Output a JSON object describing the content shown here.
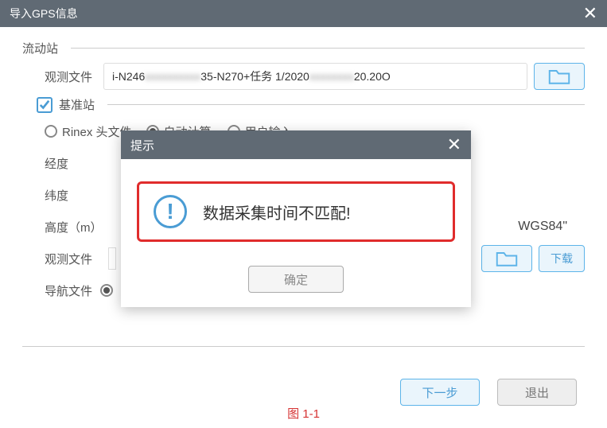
{
  "window": {
    "title": "导入GPS信息"
  },
  "rover": {
    "section": "流动站",
    "obs_label": "观测文件",
    "obs_value_p1": "i-N246",
    "obs_value_p2": "35-N270+任务 1/2020",
    "obs_value_p3": "20.20O"
  },
  "base": {
    "section": "基准站",
    "checked": true,
    "rinex_label": "Rinex 头文件",
    "mode_auto": "自动计算",
    "mode_user": "用户输入",
    "lon_label": "经度",
    "lat_label": "纬度",
    "alt_label": "高度（m）",
    "wgs_text": "WGS84\"",
    "obs_label": "观测文件",
    "nav_label": "导航文件",
    "download_label": "下载"
  },
  "footer": {
    "next": "下一步",
    "exit": "退出"
  },
  "caption": "图 1-1",
  "modal": {
    "title": "提示",
    "icon": "!",
    "message": "数据采集时间不匹配!",
    "ok": "确定"
  }
}
